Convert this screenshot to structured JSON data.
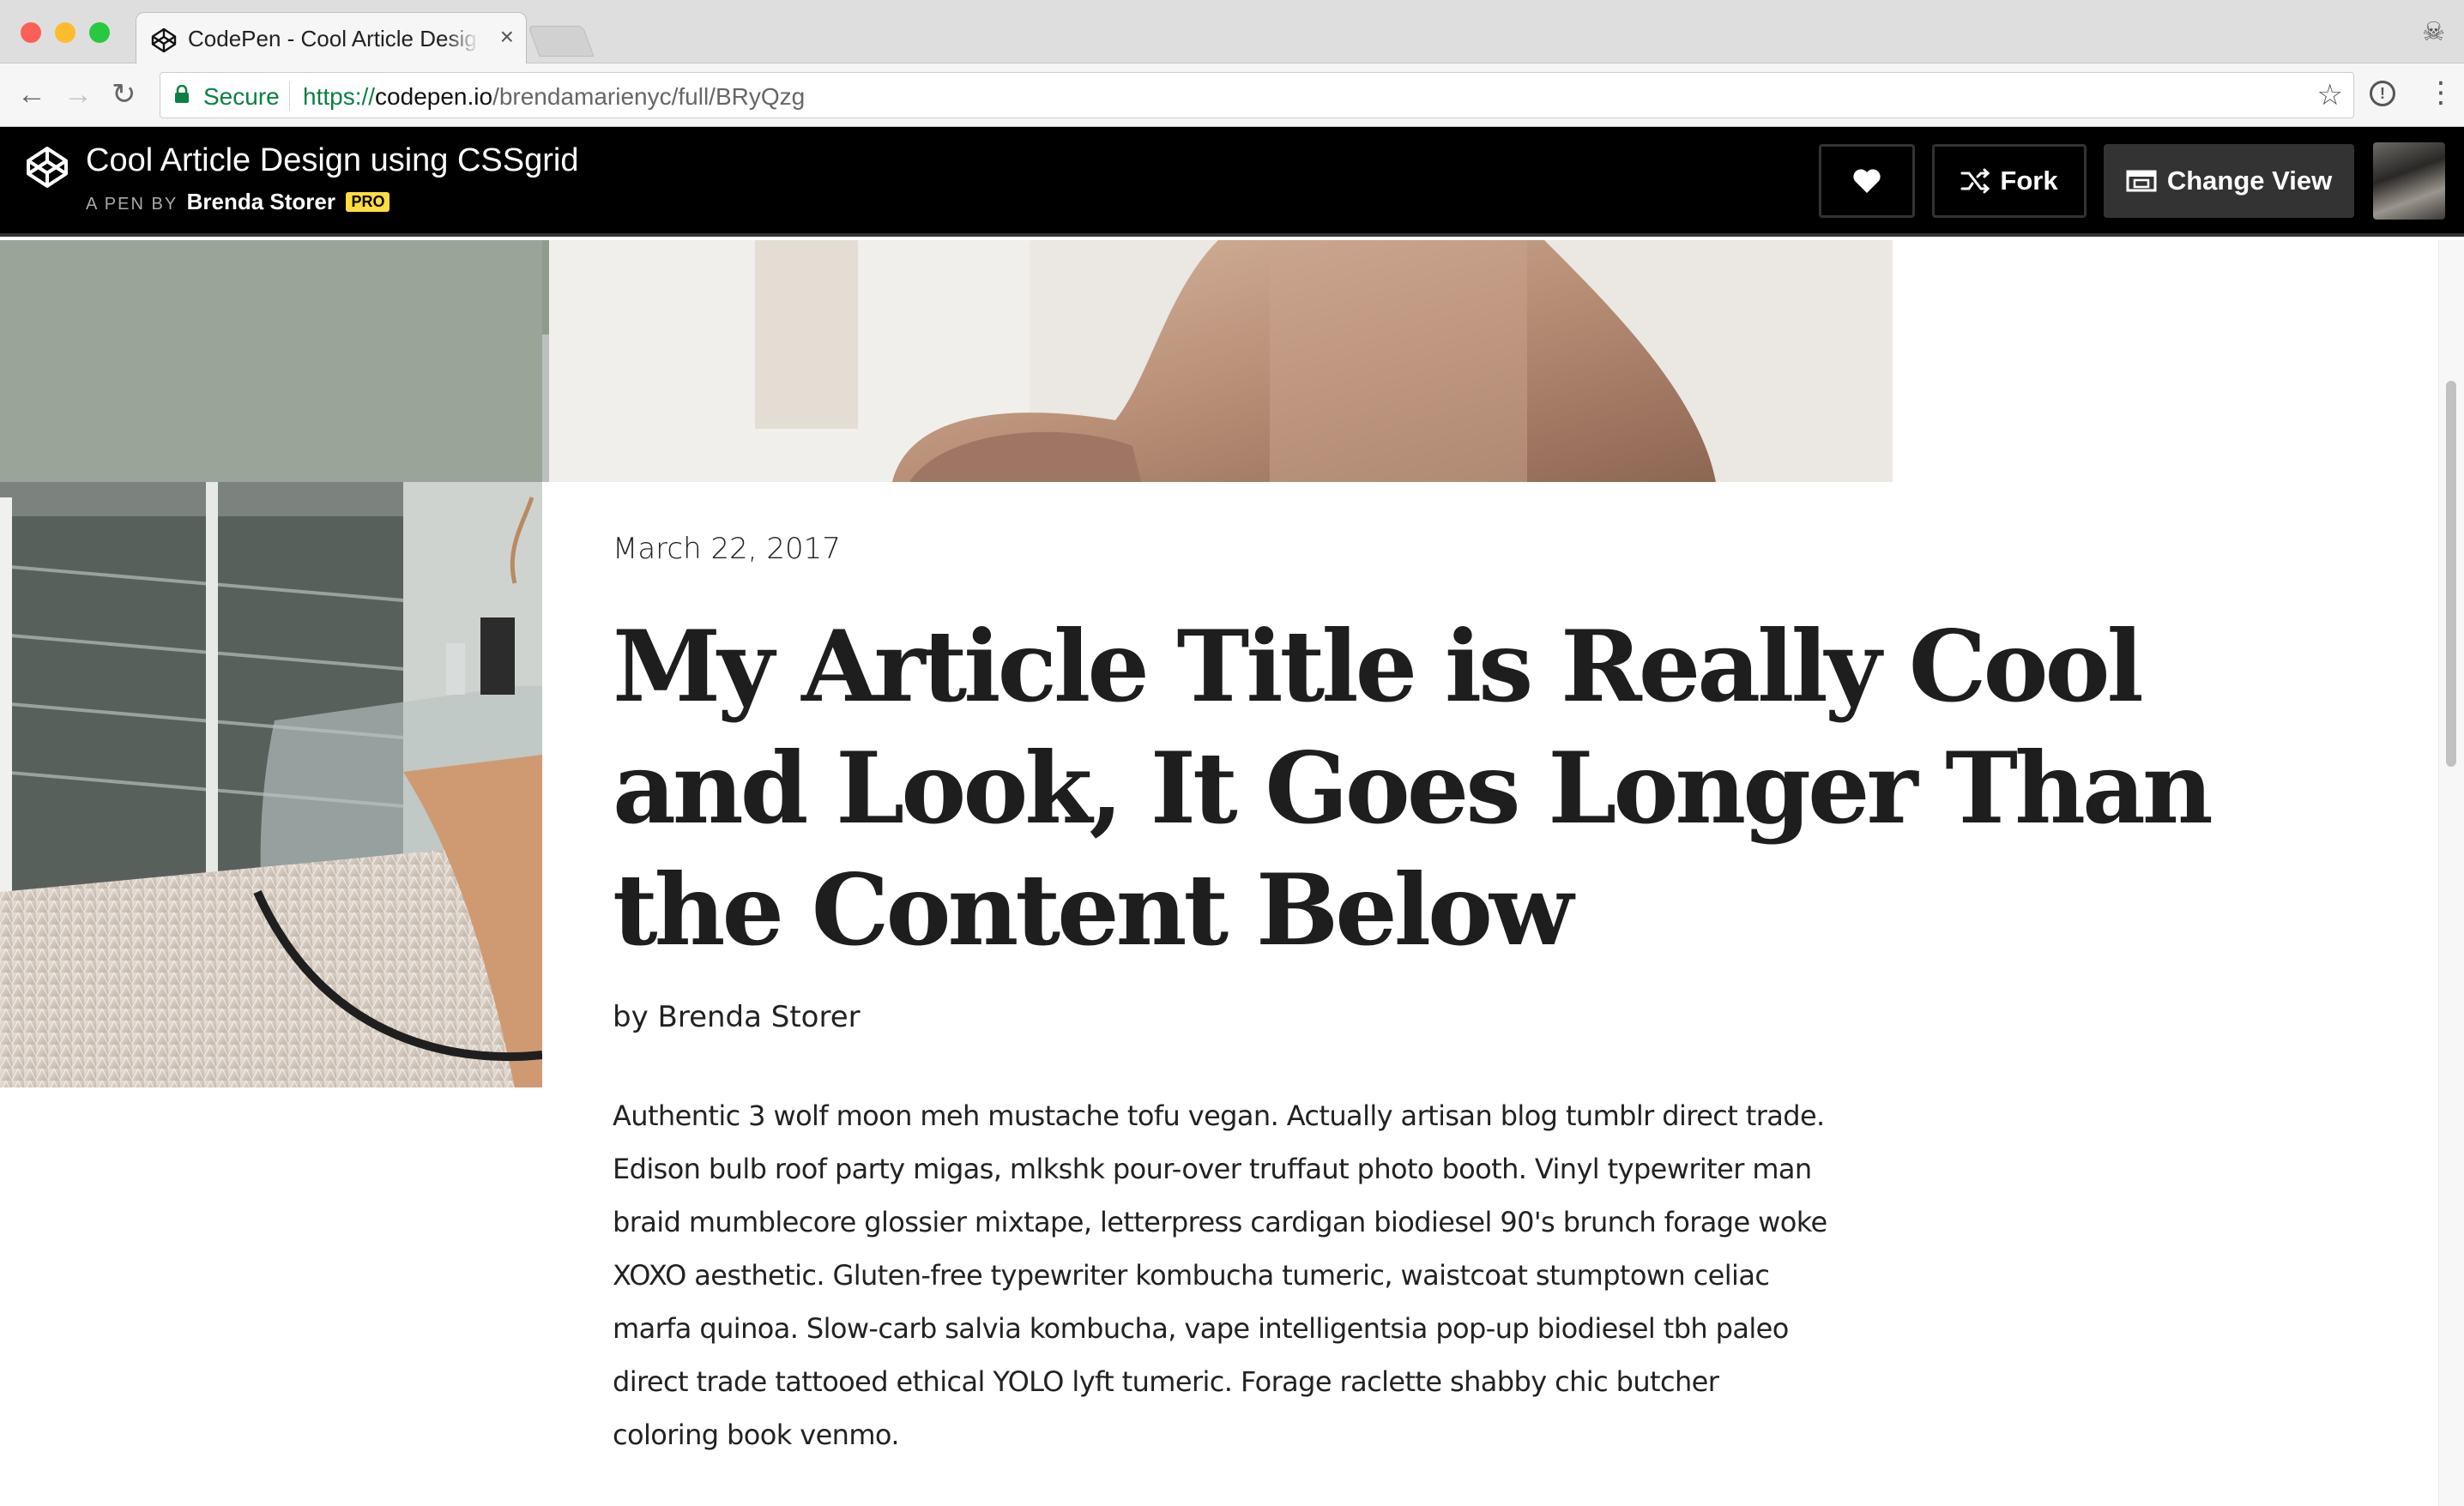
{
  "browser": {
    "tab_title": "CodePen - Cool Article Design using CSSgrid",
    "tab_close": "×",
    "secure_label": "Secure",
    "url_scheme": "https://",
    "url_host": "codepen.io",
    "url_path": "/brendamarienyc/full/BRyQzg"
  },
  "codepen": {
    "pen_title": "Cool Article Design using CSSgrid",
    "byline_prefix": "A PEN BY",
    "author": "Brenda Storer",
    "pro_badge": "PRO",
    "fork_label": "Fork",
    "change_view_label": "Change View"
  },
  "article": {
    "date": "March 22, 2017",
    "title": "My Article Title is Really Cool and Look, It Goes Longer Than the Content Below",
    "byline": "by Brenda Storer",
    "body": "Authentic 3 wolf moon meh mustache tofu vegan. Actually artisan blog tumblr direct trade. Edison bulb roof party migas, mlkshk pour-over truffaut photo booth. Vinyl typewriter man braid mumblecore glossier mixtape, letterpress cardigan biodiesel 90's brunch forage woke XOXO aesthetic. Gluten-free typewriter kombucha tumeric, waistcoat stumptown celiac marfa quinoa. Slow-carb salvia kombucha, vape intelligentsia pop-up biodiesel tbh paleo direct trade tattooed ethical YOLO lyft tumeric. Forage raclette shabby chic butcher coloring book venmo."
  },
  "colors": {
    "secure_green": "#0b8043",
    "codepen_header": "#000000",
    "pro_badge": "#ffdd40",
    "title_text": "#1e1e1e"
  }
}
